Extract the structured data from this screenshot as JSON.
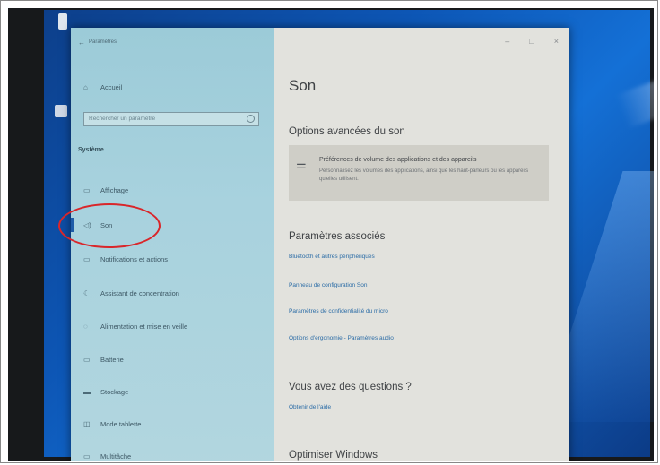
{
  "window": {
    "title": "Paramètres",
    "controls": {
      "minimize": "–",
      "maximize": "□",
      "close": "×"
    }
  },
  "sidebar": {
    "home_label": "Accueil",
    "search_placeholder": "Rechercher un paramètre",
    "section_title": "Système",
    "items": [
      {
        "label": "Affichage",
        "icon": "monitor-icon"
      },
      {
        "label": "Son",
        "icon": "speaker-icon",
        "selected": true
      },
      {
        "label": "Notifications et actions",
        "icon": "notification-icon"
      },
      {
        "label": "Assistant de concentration",
        "icon": "moon-icon"
      },
      {
        "label": "Alimentation et mise en veille",
        "icon": "power-icon"
      },
      {
        "label": "Batterie",
        "icon": "battery-icon"
      },
      {
        "label": "Stockage",
        "icon": "storage-icon"
      },
      {
        "label": "Mode tablette",
        "icon": "tablet-icon"
      },
      {
        "label": "Multitâche",
        "icon": "multitask-icon"
      }
    ]
  },
  "content": {
    "page_title": "Son",
    "advanced_heading": "Options avancées du son",
    "advanced_card": {
      "title": "Préférences de volume des applications et des appareils",
      "description": "Personnalisez les volumes des applications, ainsi que les haut-parleurs ou les appareils qu'elles utilisent."
    },
    "related_heading": "Paramètres associés",
    "related_links": [
      "Bluetooth et autres périphériques",
      "Panneau de configuration Son",
      "Paramètres de confidentialité du micro",
      "Options d'ergonomie - Paramètres audio"
    ],
    "questions_heading": "Vous avez des questions ?",
    "help_link": "Obtenir de l'aide",
    "optimize_heading": "Optimiser Windows"
  },
  "colors": {
    "sidebar_bg": "#a8d2de",
    "content_bg": "#e2e2dd",
    "link": "#2b6ca6",
    "annotation_circle": "#d9262a",
    "desktop_blue": "#0d56b5"
  }
}
